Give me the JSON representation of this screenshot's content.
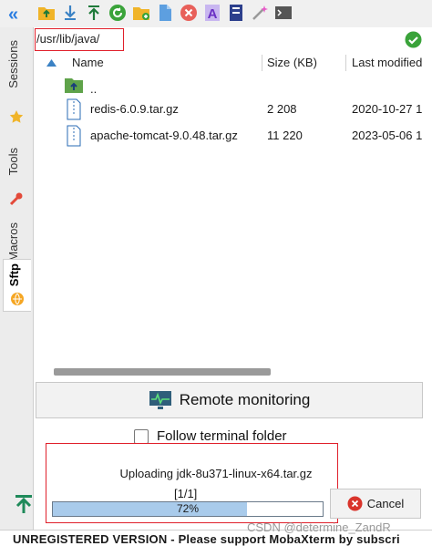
{
  "toolbar": {
    "collapse_glyph": "«",
    "icons": [
      "parent-folder-icon",
      "download-icon",
      "upload-icon",
      "refresh-icon",
      "new-folder-icon",
      "new-file-icon",
      "delete-icon",
      "rename-icon",
      "file-permissions-icon",
      "quick-connect-icon",
      "terminal-icon"
    ]
  },
  "side_tabs": {
    "sessions": "Sessions",
    "tools": "Tools",
    "macros": "Macros",
    "sftp": "Sftp"
  },
  "path": {
    "value": "/usr/lib/java/"
  },
  "filelist": {
    "columns": {
      "name": "Name",
      "size": "Size (KB)",
      "modified": "Last modified"
    },
    "parent_label": "..",
    "files": [
      {
        "name": "redis-6.0.9.tar.gz",
        "size": "2 208",
        "modified": "2020-10-27 1"
      },
      {
        "name": "apache-tomcat-9.0.48.tar.gz",
        "size": "11 220",
        "modified": "2023-05-06 1"
      }
    ]
  },
  "remote_monitoring": {
    "label": "Remote monitoring"
  },
  "follow_terminal": {
    "label": "Follow terminal folder",
    "checked": false
  },
  "upload": {
    "status": "Uploading jdk-8u371-linux-x64.tar.gz",
    "count": "[1/1]",
    "percent_text": "72%",
    "progress": 0.72,
    "cancel_label": "Cancel"
  },
  "status_bar": {
    "text": "UNREGISTERED VERSION  -  Please support MobaXterm by subscri"
  },
  "watermark": "CSDN @determine_ZandR",
  "colors": {
    "accent": "#2a7de1",
    "highlight_box": "#e0202b",
    "progress_fill": "#a9cbeb"
  }
}
